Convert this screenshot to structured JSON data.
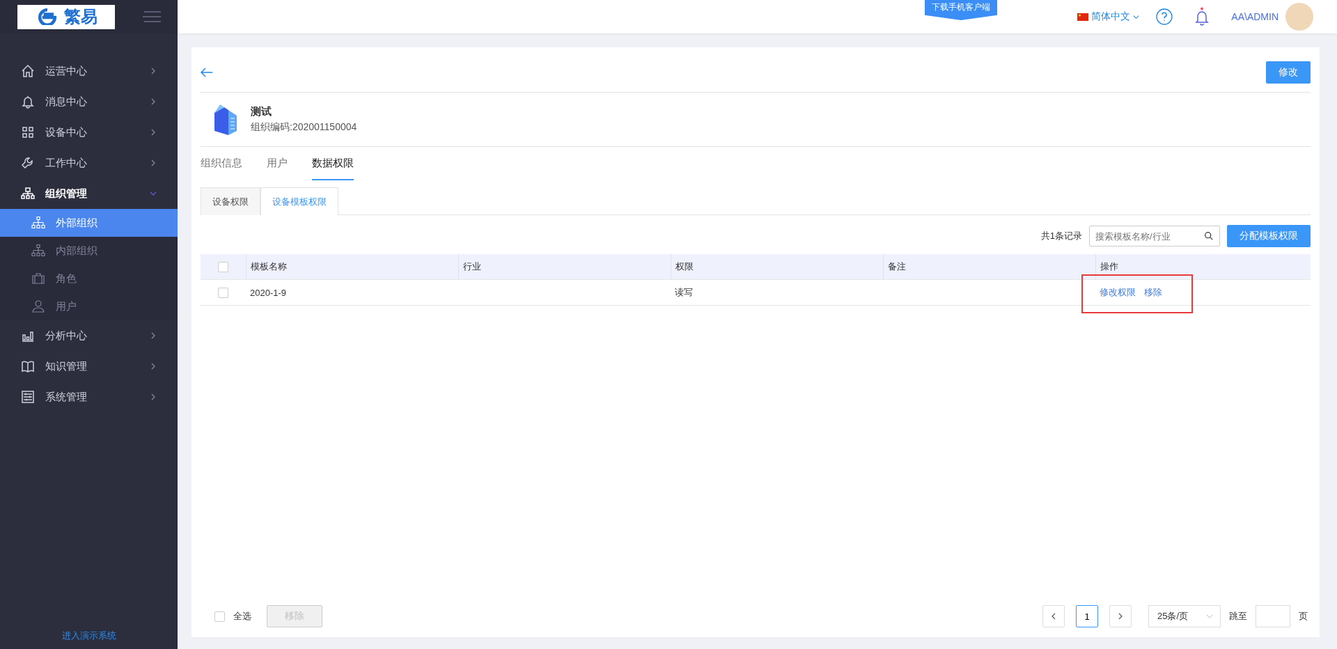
{
  "logo": {
    "text": "繁易"
  },
  "sidebar": {
    "items": [
      {
        "label": "运营中心",
        "kind": "home",
        "expanded": false
      },
      {
        "label": "消息中心",
        "kind": "bell",
        "expanded": false
      },
      {
        "label": "设备中心",
        "kind": "grid",
        "expanded": false
      },
      {
        "label": "工作中心",
        "kind": "wrench",
        "expanded": false
      },
      {
        "label": "组织管理",
        "kind": "org",
        "expanded": true,
        "children": [
          {
            "label": "外部组织",
            "kind": "org",
            "selected": true
          },
          {
            "label": "内部组织",
            "kind": "org",
            "selected": false
          },
          {
            "label": "角色",
            "kind": "case",
            "selected": false
          },
          {
            "label": "用户",
            "kind": "user",
            "selected": false
          }
        ]
      },
      {
        "label": "分析中心",
        "kind": "chart",
        "expanded": false
      },
      {
        "label": "知识管理",
        "kind": "book",
        "expanded": false
      },
      {
        "label": "系统管理",
        "kind": "settings",
        "expanded": false
      }
    ],
    "footer_link": "进入演示系统"
  },
  "header": {
    "download_banner": "下载手机客户端",
    "language": "简体中文",
    "user": "AA\\ADMIN"
  },
  "page": {
    "edit_button": "修改",
    "org_name": "测试",
    "org_code": "组织编码:202001150004",
    "tabs": [
      {
        "label": "组织信息",
        "selected": false
      },
      {
        "label": "用户",
        "selected": false
      },
      {
        "label": "数据权限",
        "selected": true
      }
    ],
    "subtabs": [
      {
        "label": "设备权限",
        "selected": false
      },
      {
        "label": "设备模板权限",
        "selected": true
      }
    ],
    "record_count": "共1条记录",
    "search": {
      "placeholder": "搜索模板名称/行业"
    },
    "assign_button": "分配模板权限",
    "table": {
      "header_checked": false,
      "columns": [
        "模板名称",
        "行业",
        "权限",
        "备注",
        "操作"
      ],
      "rows": [
        {
          "checked": false,
          "annotated": true,
          "cells": [
            "2020-1-9",
            "",
            "读写",
            ""
          ],
          "actions": [
            "修改权限",
            "移除"
          ]
        }
      ]
    },
    "footer": {
      "select_all": {
        "label": "全选",
        "checked": false
      },
      "remove_button": {
        "label": "移除",
        "disabled": true
      }
    },
    "pagination": {
      "pages": [
        {
          "label": "1",
          "selected": true
        }
      ],
      "page_size": "25条/页",
      "jump_label": "跳至",
      "page_suffix": "页"
    }
  }
}
